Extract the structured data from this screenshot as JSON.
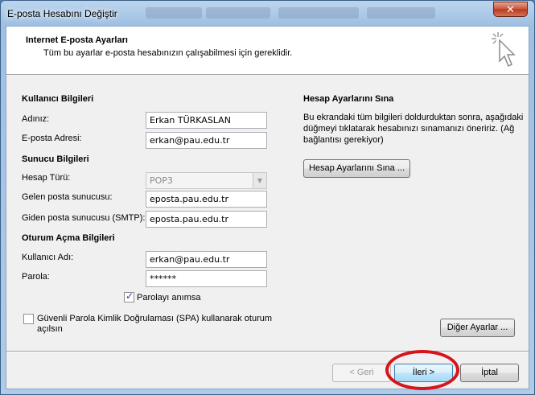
{
  "window": {
    "title": "E-posta Hesabını Değiştir",
    "close_label": "✕"
  },
  "header": {
    "title": "Internet E-posta Ayarları",
    "subtitle": "Tüm bu ayarlar e-posta hesabınızın çalışabilmesi için gereklidir."
  },
  "user_info": {
    "section": "Kullanıcı Bilgileri",
    "name_label": "Adınız:",
    "name_value": "Erkan TÜRKASLAN",
    "email_label": "E-posta Adresi:",
    "email_value": "erkan@pau.edu.tr"
  },
  "server_info": {
    "section": "Sunucu Bilgileri",
    "account_type_label": "Hesap Türü:",
    "account_type_value": "POP3",
    "incoming_label": "Gelen posta sunucusu:",
    "incoming_value": "eposta.pau.edu.tr",
    "outgoing_label": "Giden posta sunucusu (SMTP):",
    "outgoing_value": "eposta.pau.edu.tr"
  },
  "logon_info": {
    "section": "Oturum Açma Bilgileri",
    "username_label": "Kullanıcı Adı:",
    "username_value": "erkan@pau.edu.tr",
    "password_label": "Parola:",
    "password_value": "******",
    "remember_label": "Parolayı anımsa",
    "remember_checked": true,
    "spa_label_line1": "Güvenli Parola Kimlik Doğrulaması (SPA) kullanarak oturum",
    "spa_label_line2": "açılsın",
    "spa_checked": false
  },
  "test_settings": {
    "section": "Hesap Ayarlarını Sına",
    "description_line1": "Bu ekrandaki tüm bilgileri doldurduktan sonra, aşağıdaki",
    "description_line2": "düğmeyi tıklatarak hesabınızı sınamanızı öneririz. (Ağ",
    "description_line3": "bağlantısı gerekiyor)",
    "test_button": "Hesap Ayarlarını Sına ...",
    "more_settings_button": "Diğer Ayarlar ..."
  },
  "footer": {
    "back_button": "< Geri",
    "next_button": "İleri >",
    "cancel_button": "İptal"
  },
  "colors": {
    "highlight_circle": "#d6141c",
    "title_bar": "#9fc0e3"
  }
}
